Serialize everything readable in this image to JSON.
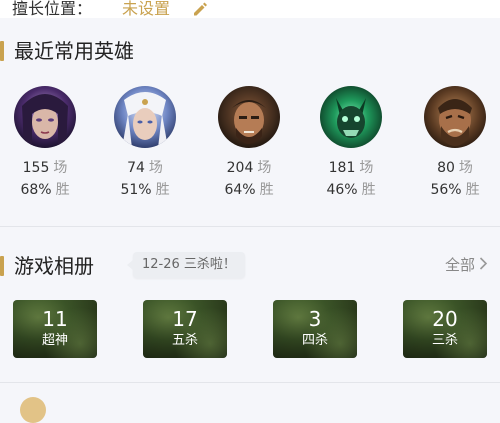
{
  "profile": {
    "position_label": "擅长位置：",
    "position_value": "未设置"
  },
  "recent_heroes": {
    "title": "最近常用英雄",
    "items": [
      {
        "games": "155",
        "games_unit": "场",
        "win_rate": "68%",
        "win_unit": "胜"
      },
      {
        "games": "74",
        "games_unit": "场",
        "win_rate": "51%",
        "win_unit": "胜"
      },
      {
        "games": "204",
        "games_unit": "场",
        "win_rate": "64%",
        "win_unit": "胜"
      },
      {
        "games": "181",
        "games_unit": "场",
        "win_rate": "46%",
        "win_unit": "胜"
      },
      {
        "games": "80",
        "games_unit": "场",
        "win_rate": "56%",
        "win_unit": "胜"
      }
    ]
  },
  "album": {
    "title": "游戏相册",
    "tooltip": "12-26 三杀啦！",
    "see_all": "全部",
    "items": [
      {
        "count": "11",
        "label": "超神"
      },
      {
        "count": "17",
        "label": "五杀"
      },
      {
        "count": "3",
        "label": "四杀"
      },
      {
        "count": "20",
        "label": "三杀"
      }
    ]
  },
  "colors": {
    "accent": "#c9a24f",
    "background": "#f5f6fa"
  },
  "icons": {
    "edit": "pencil-icon",
    "see_all": "chevron-right-icon"
  }
}
